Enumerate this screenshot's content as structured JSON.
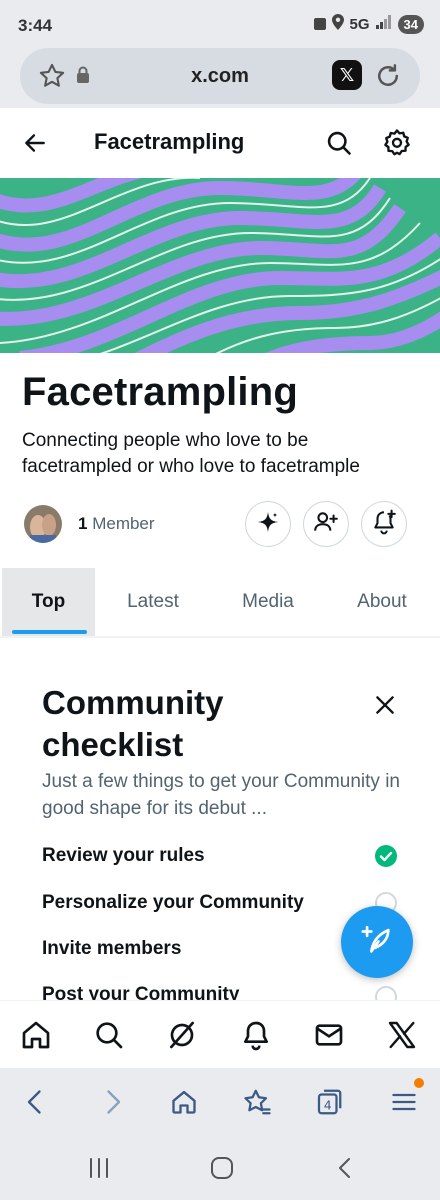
{
  "status_bar": {
    "time": "3:44",
    "network": "5G",
    "battery": "34"
  },
  "browser": {
    "url": "x.com",
    "tab_count": "4"
  },
  "header": {
    "title": "Facetrampling"
  },
  "community": {
    "name": "Facetrampling",
    "description": "Connecting people who love to be facetrampled or who love to facetrample",
    "member_count": "1",
    "member_label": "Member"
  },
  "tabs": [
    {
      "label": "Top",
      "active": true
    },
    {
      "label": "Latest",
      "active": false
    },
    {
      "label": "Media",
      "active": false
    },
    {
      "label": "About",
      "active": false
    }
  ],
  "checklist": {
    "title": "Community checklist",
    "subtitle": "Just a few things to get your Community in good shape for its debut ...",
    "items": [
      {
        "label": "Review your rules",
        "done": true
      },
      {
        "label": "Personalize your Community",
        "done": false
      },
      {
        "label": "Invite members",
        "done": false
      },
      {
        "label": "Post your Community",
        "done": false
      }
    ]
  },
  "colors": {
    "accent": "#1d9bf0",
    "done": "#00ba7c",
    "banner_green": "#3cb386",
    "banner_purple": "#a78df0"
  },
  "icons": {
    "bottom_nav": [
      "home-icon",
      "search-icon",
      "grok-icon",
      "bell-icon",
      "mail-icon",
      "x-logo-icon"
    ],
    "toolbar": [
      "back-icon",
      "forward-icon",
      "home-icon",
      "bookmarks-icon",
      "tabs-icon",
      "menu-icon"
    ]
  }
}
